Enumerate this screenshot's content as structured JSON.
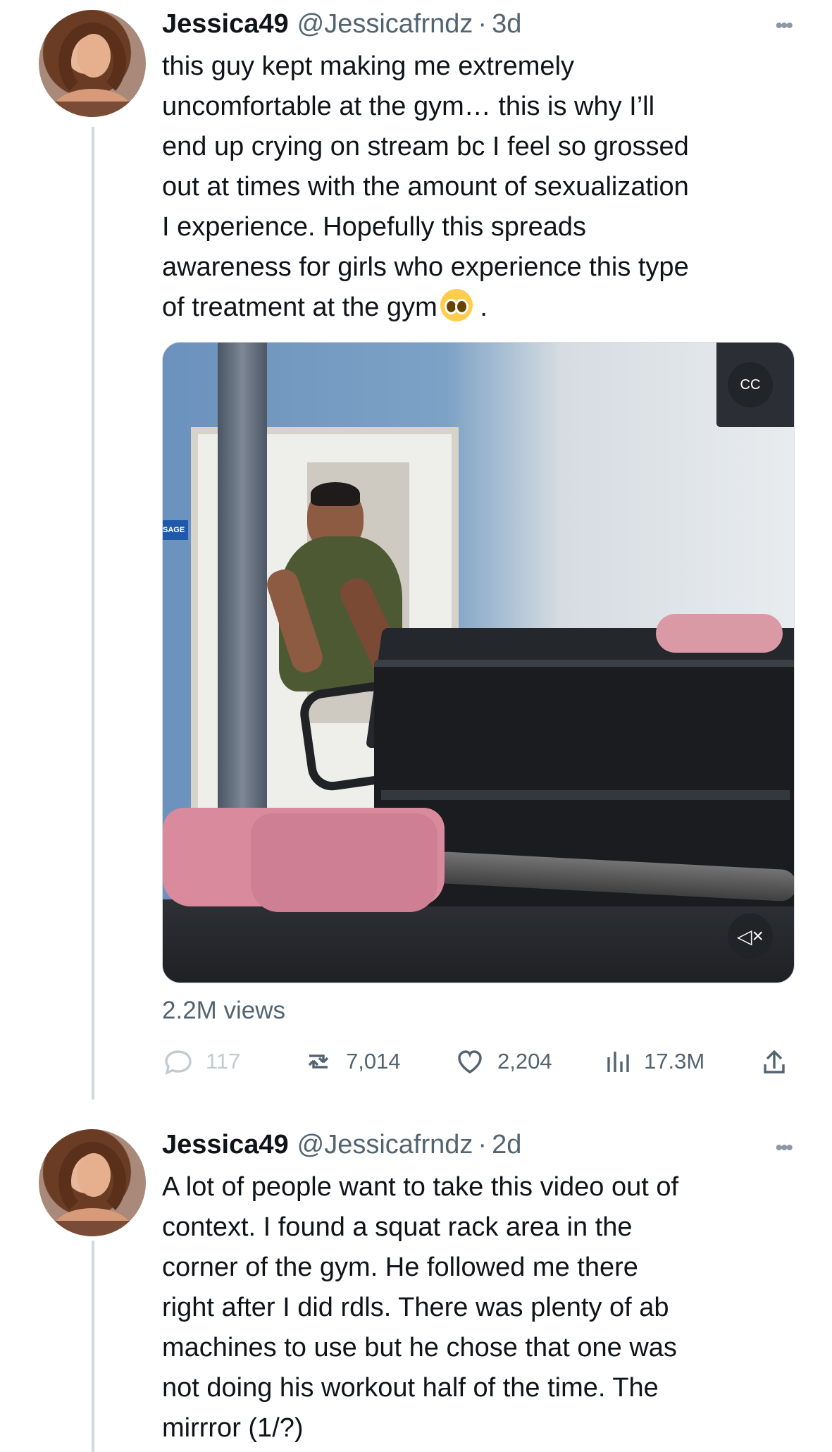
{
  "tweets": [
    {
      "name": "Jessica49",
      "handle": "@Jessicafrndz",
      "dot": "·",
      "time": "3d",
      "text_lines": [
        "this guy kept making me extremely",
        "uncomfortable at the gym… this is why I’ll",
        "end up crying on stream bc I feel so grossed",
        "out at times with the amount of sexualization",
        "I experience. Hopefully this spreads",
        "awareness for girls who experience this type",
        "of treatment at the gym"
      ],
      "ending": ".",
      "media": {
        "sign_text": "SAGE",
        "cc_label": "CC",
        "mute_label": "×"
      },
      "views": "2.2M views",
      "stats": {
        "replies": "117",
        "retweets": "7,014",
        "likes": "2,204",
        "impressions": "17.3M"
      }
    },
    {
      "name": "Jessica49",
      "handle": "@Jessicafrndz",
      "dot": "·",
      "time": "2d",
      "text_lines": [
        "A lot of people want to take this video out of",
        "context. I found a squat rack area in the",
        "corner of the gym. He followed me there",
        "right after I did rdls. There was plenty of ab",
        "machines to use but he chose that one was",
        "not doing his workout half of the time. The",
        "mirrror (1/?)"
      ]
    }
  ],
  "icons": {
    "more": "more-icon",
    "reply": "reply-icon",
    "retweet": "retweet-icon",
    "like": "heart-icon",
    "analytics": "analytics-icon",
    "share": "share-icon",
    "emoji": "pleading-face-emoji"
  },
  "colors": {
    "text": "#0f1419",
    "secondary": "#536471",
    "thread_line": "#cfd9de",
    "emoji": "#ffcc4d"
  }
}
